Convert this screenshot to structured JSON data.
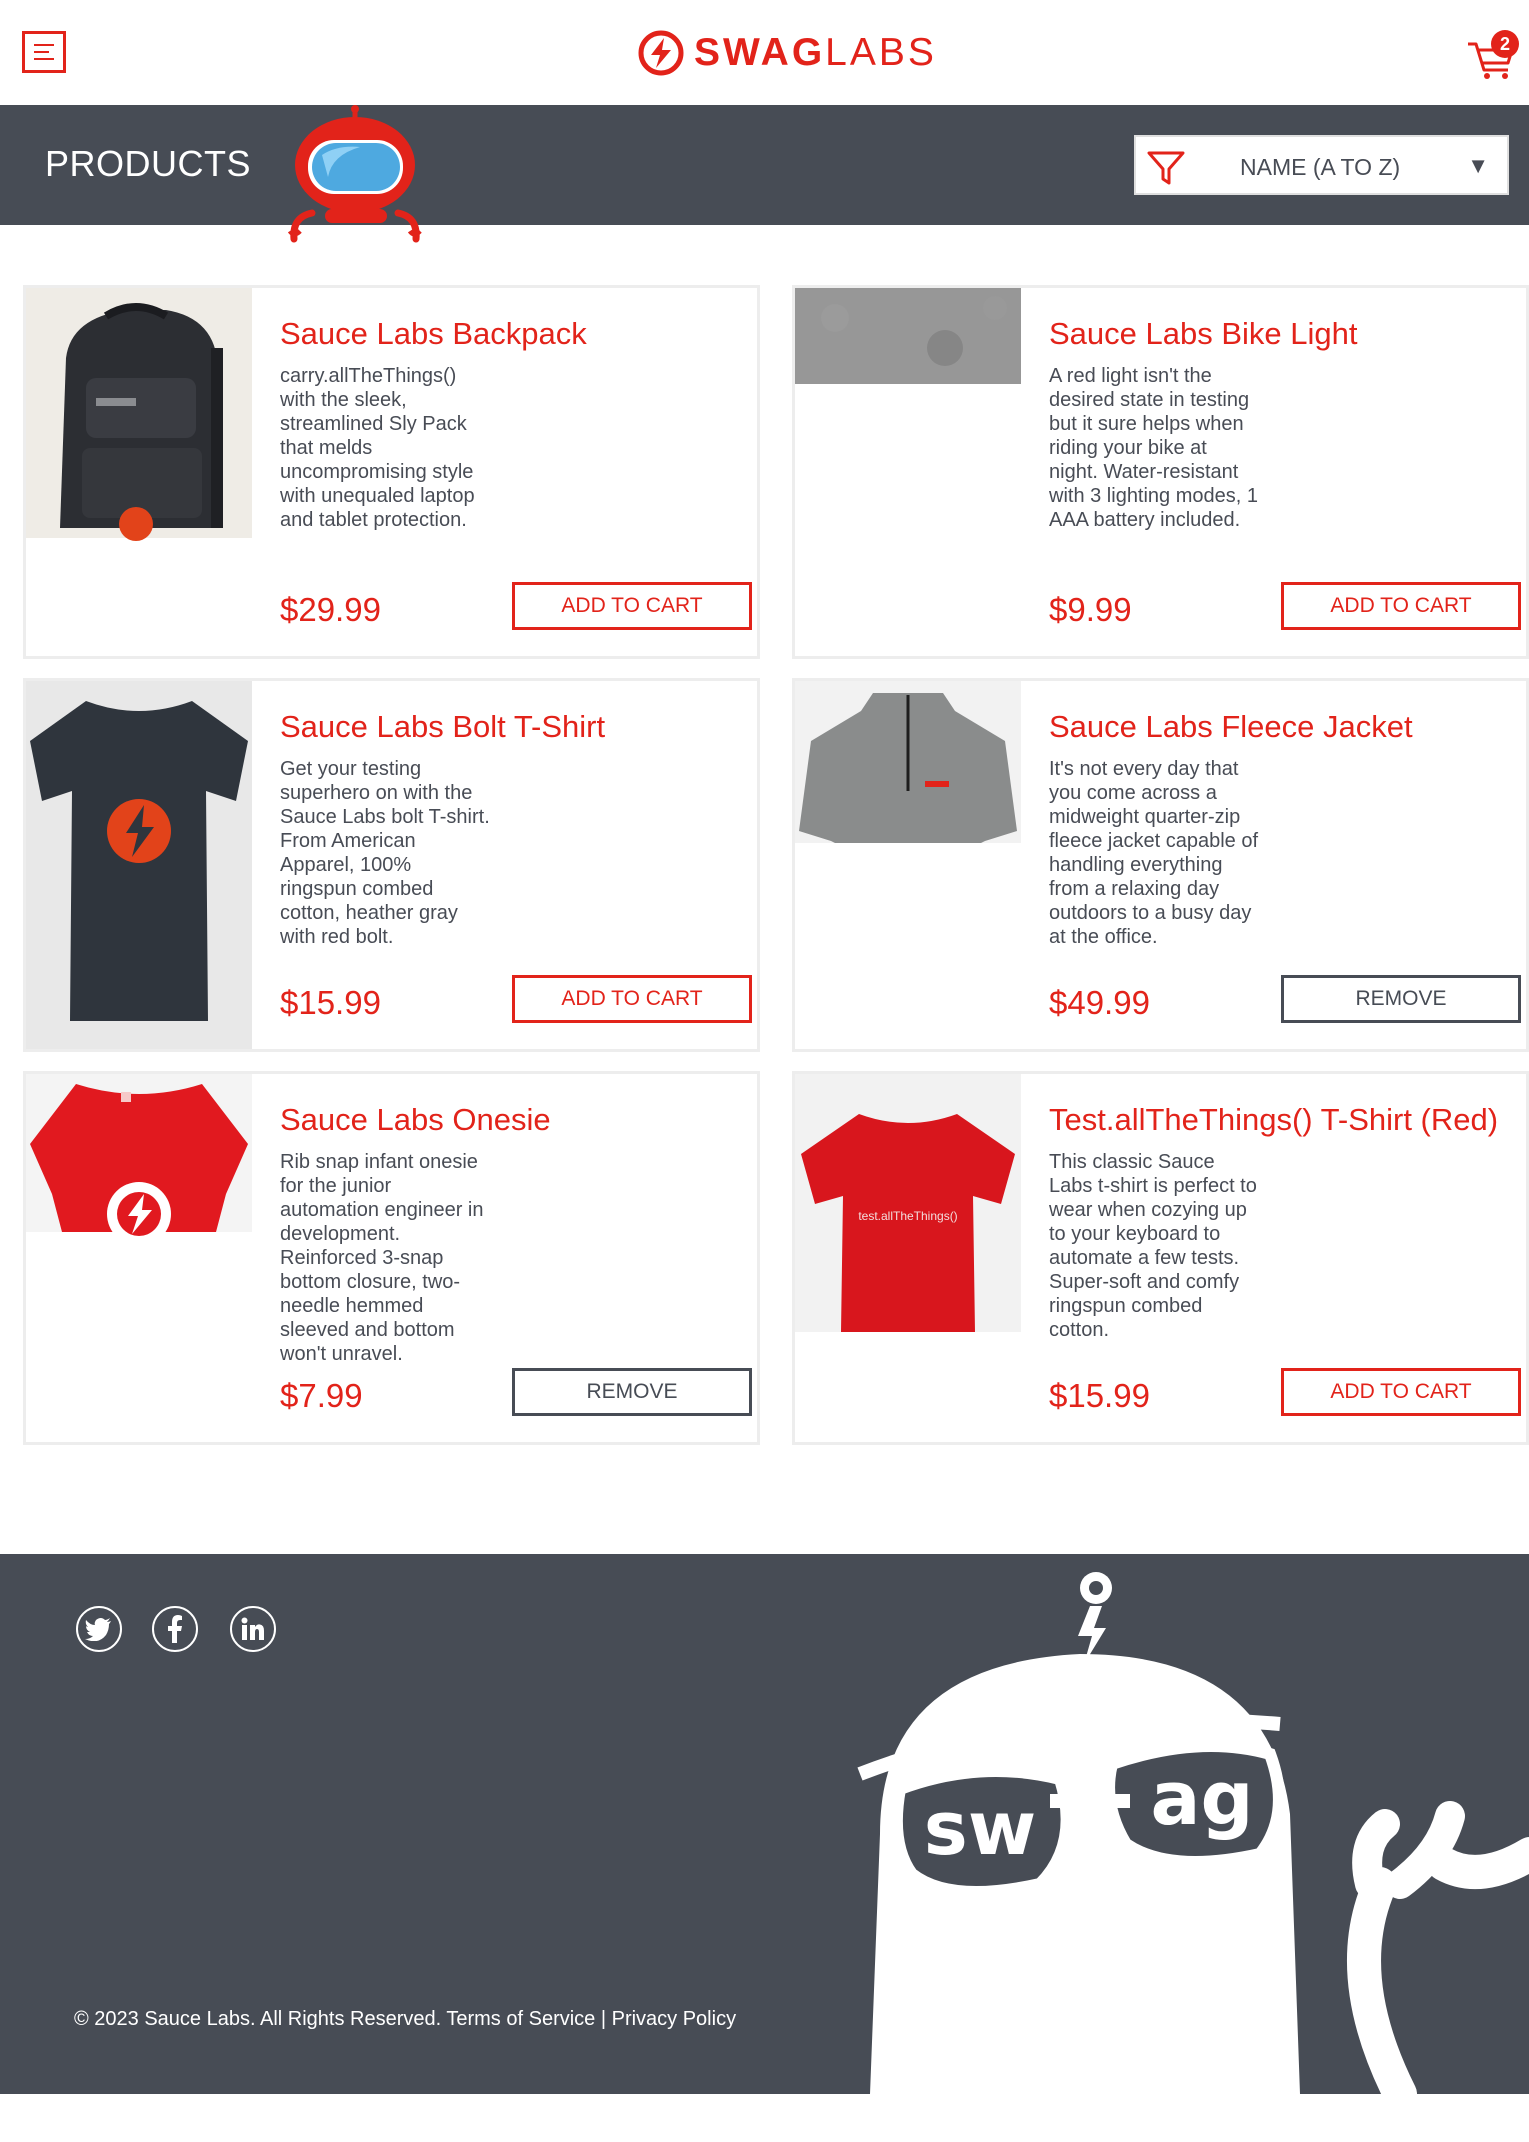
{
  "header": {
    "logo": {
      "bold": "SWAG",
      "light": "LABS"
    },
    "cart_count": "2"
  },
  "subheader": {
    "title": "PRODUCTS",
    "sort_value": "NAME (A TO Z)"
  },
  "products": [
    {
      "name": "Sauce Labs Backpack",
      "description": "carry.allTheThings() with the sleek, streamlined Sly Pack that melds uncompromising style with unequaled laptop and tablet protection.",
      "price": "$29.99",
      "button": "ADD TO CART",
      "state": "add"
    },
    {
      "name": "Sauce Labs Bike Light",
      "description": "A red light isn't the desired state in testing but it sure helps when riding your bike at night. Water-resistant with 3 lighting modes, 1 AAA battery included.",
      "price": "$9.99",
      "button": "ADD TO CART",
      "state": "add"
    },
    {
      "name": "Sauce Labs Bolt T-Shirt",
      "description": "Get your testing superhero on with the Sauce Labs bolt T-shirt. From American Apparel, 100% ringspun combed cotton, heather gray with red bolt.",
      "price": "$15.99",
      "button": "ADD TO CART",
      "state": "add"
    },
    {
      "name": "Sauce Labs Fleece Jacket",
      "description": "It's not every day that you come across a midweight quarter-zip fleece jacket capable of handling everything from a relaxing day outdoors to a busy day at the office.",
      "price": "$49.99",
      "button": "REMOVE",
      "state": "remove"
    },
    {
      "name": "Sauce Labs Onesie",
      "description": "Rib snap infant onesie for the junior automation engineer in development. Reinforced 3-snap bottom closure, two-needle hemmed sleeved and bottom won't unravel.",
      "price": "$7.99",
      "button": "REMOVE",
      "state": "remove"
    },
    {
      "name": "Test.allTheThings() T-Shirt (Red)",
      "description": "This classic Sauce Labs t-shirt is perfect to wear when cozying up to your keyboard to automate a few tests. Super-soft and comfy ringspun combed cotton.",
      "price": "$15.99",
      "button": "ADD TO CART",
      "state": "add",
      "shirt_print": "test.allTheThings()"
    }
  ],
  "footer": {
    "social": [
      "twitter-icon",
      "facebook-icon",
      "linkedin-icon"
    ],
    "copyright": "© 2023 Sauce Labs. All Rights Reserved. Terms of Service | Privacy Policy",
    "robot_glasses": {
      "left": "sw",
      "right": "ag"
    }
  },
  "colors": {
    "accent": "#e2231a",
    "dark": "#474c55",
    "border": "#ededed"
  }
}
